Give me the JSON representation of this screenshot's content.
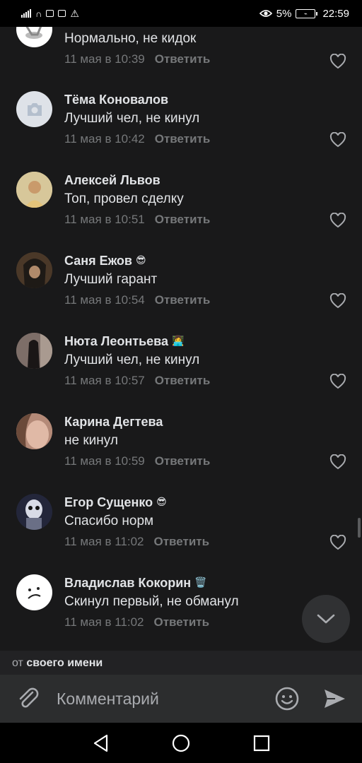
{
  "status_bar": {
    "battery_percent": "5%",
    "time": "22:59",
    "icons": [
      "signal-icon",
      "headset-icon",
      "mail-icon",
      "gallery-icon",
      "warning-icon",
      "eye-icon",
      "battery-icon"
    ]
  },
  "comments": [
    {
      "name": "",
      "emoji": "",
      "text": "Нормально, не кидок",
      "date": "11 мая в 10:39",
      "reply": "Ответить",
      "avatar": "partial-avatar"
    },
    {
      "name": "Тёма Коновалов",
      "emoji": "",
      "text": "Лучший чел, не кинул",
      "date": "11 мая в 10:42",
      "reply": "Ответить",
      "avatar": "camera-placeholder"
    },
    {
      "name": "Алексей Львов",
      "emoji": "",
      "text": "Топ, провел сделку",
      "date": "11 мая в 10:51",
      "reply": "Ответить",
      "avatar": "photo"
    },
    {
      "name": "Саня Ежов",
      "emoji": "😎",
      "text": "Лучший гарант",
      "date": "11 мая в 10:54",
      "reply": "Ответить",
      "avatar": "photo"
    },
    {
      "name": "Нюта Леонтьева",
      "emoji": "👩‍💻",
      "text": "Лучший чел, не кинул",
      "date": "11 мая в 10:57",
      "reply": "Ответить",
      "avatar": "photo"
    },
    {
      "name": "Карина Дегтева",
      "emoji": "",
      "text": "не кинул",
      "date": "11 мая в 10:59",
      "reply": "Ответить",
      "avatar": "photo"
    },
    {
      "name": "Егор Сущенко",
      "emoji": "😎",
      "text": "Спасибо норм",
      "date": "11 мая в 11:02",
      "reply": "Ответить",
      "avatar": "photo"
    },
    {
      "name": "Владислав Кокорин",
      "emoji": "🗑️",
      "text": "Скинул первый, не обманул",
      "date": "11 мая в 11:02",
      "reply": "Ответить",
      "avatar": "sad-face"
    }
  ],
  "from_bar": {
    "prefix": "от",
    "value": "своего имени"
  },
  "composer": {
    "placeholder": "Комментарий"
  },
  "colors": {
    "background": "#19191a",
    "text_primary": "#e1e3e6",
    "text_secondary": "#76787a",
    "composer_bg": "#2c2d2e"
  }
}
